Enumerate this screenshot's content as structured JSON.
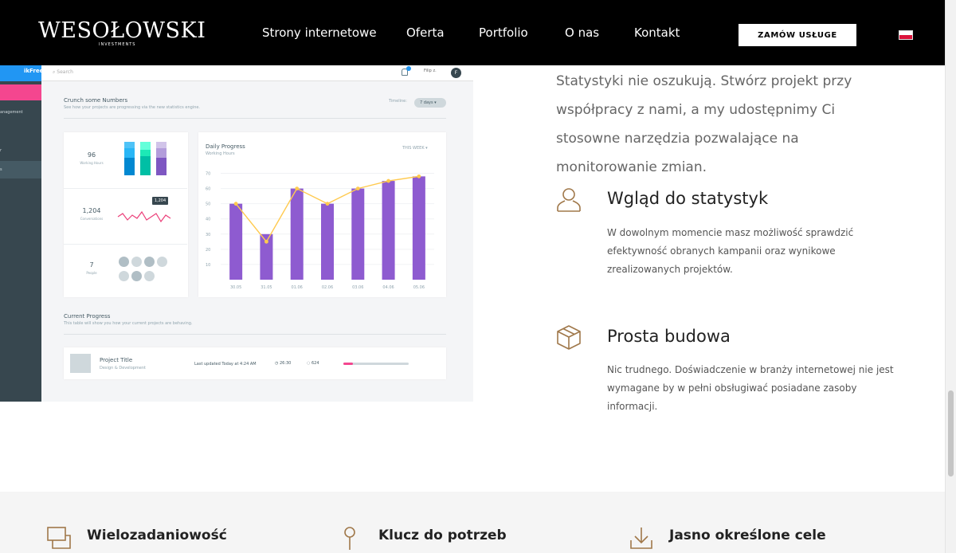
{
  "header": {
    "logo_main": "WESOŁOWSKI",
    "logo_sub": "INVESTMENTS",
    "nav": [
      {
        "label": "Strony internetowe"
      },
      {
        "label": "Oferta"
      },
      {
        "label": "Portfolio"
      },
      {
        "label": "O nas"
      },
      {
        "label": "Kontakt"
      }
    ],
    "cta_label": "ZAMÓW USŁUGE",
    "flag": "poland-flag-icon"
  },
  "mockup": {
    "brand": "ikFree",
    "sidebar_items": [
      "anagement",
      "r",
      "s"
    ],
    "search_placeholder": "Search",
    "user_name": "Filip z.",
    "user_initial": "F",
    "section_title": "Crunch some Numbers",
    "section_sub": "See how your projects are progressing via the new statistics engine.",
    "timeline_label": "Timeline:",
    "timeline_value": "7 days",
    "stats": [
      {
        "value": "96",
        "label": "Working Hours"
      },
      {
        "value": "1,204",
        "label": "Conversations"
      },
      {
        "value": "7",
        "label": "People"
      }
    ],
    "tooltip": "1,204",
    "daily_title": "Daily Progress",
    "daily_sub": "Working Hours",
    "week_filter": "THIS WEEK",
    "current_title": "Current Progress",
    "current_sub": "This table will show you how your current projects are behaving.",
    "project_title": "Project Title",
    "project_sub": "Design & Development",
    "last_updated": "Last updated Today at 4:24 AM",
    "time_stat": "26:30",
    "comments_stat": "624",
    "progress": 0.15
  },
  "chart_data": {
    "type": "bar",
    "title": "Daily Progress",
    "xlabel": "",
    "ylabel": "Working Hours",
    "categories": [
      "30.05",
      "31.05",
      "01.06",
      "02.06",
      "03.06",
      "04.06",
      "05.06"
    ],
    "series": [
      {
        "values": [
          50,
          30,
          60,
          50,
          60,
          65,
          68
        ],
        "color": "#8e5bd0"
      },
      {
        "values": [
          50,
          25,
          60,
          50,
          60,
          65,
          68
        ],
        "color": "#ffca4f"
      }
    ],
    "yticks": [
      10,
      20,
      30,
      40,
      50,
      60,
      70
    ],
    "ylim": [
      0,
      75
    ]
  },
  "intro": "Statystyki nie oszukują. Stwórz projekt przy współpracy z nami, a my udostępnimy Ci stosowne narzędzia pozwalające na monitorowanie zmian.",
  "features": [
    {
      "icon": "user-icon",
      "title": "Wgląd do statystyk",
      "desc": "W dowolnym momencie masz możliwość sprawdzić efektywność obranych kampanii oraz wynikowe zrealizowanych projektów."
    },
    {
      "icon": "box-icon",
      "title": "Prosta budowa",
      "desc": "Nic trudnego. Doświadczenie w branży internetowej nie jest wymagane by w pełni obsługiwać posiadane zasoby informacji."
    }
  ],
  "bottom": [
    {
      "icon": "windows-icon",
      "title": "Wielozadaniowość"
    },
    {
      "icon": "pin-icon",
      "title": "Klucz do potrzeb"
    },
    {
      "icon": "download-icon",
      "title": "Jasno określone cele"
    }
  ],
  "colors": {
    "accent": "#a0784a",
    "header_bg": "#000000",
    "bar": "#8e5bd0",
    "line": "#ffca4f"
  }
}
